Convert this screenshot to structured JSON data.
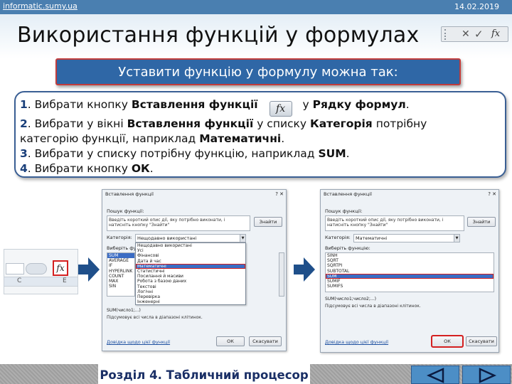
{
  "header": {
    "site": "informatic.sumy.ua",
    "date": "14.02.2019",
    "title": "Використання функцій у формулах"
  },
  "formula_bar_icons": [
    "x-icon",
    "check-icon",
    "fx-icon"
  ],
  "formula_bar": {
    "fx": "fx",
    "x": "✕",
    "check": "✓"
  },
  "subtitle": "Уставити функцію у формулу можна так:",
  "steps": [
    {
      "num": "1",
      "pre": ". Вибрати кнопку ",
      "b1": "Вставлення функції",
      "mid": " у ",
      "b2": "Рядку формул",
      "post": "."
    },
    {
      "num": "2",
      "pre": ". Вибрати у вікні ",
      "b1": "Вставлення функції",
      "mid": " у списку ",
      "b2": "Категорія",
      "post": " потрібну"
    },
    {
      "cont": "категорію функції, наприклад ",
      "b1": "Математичні",
      "post": "."
    },
    {
      "num": "3",
      "pre": ". Вибрати у списку потрібну функцію, наприклад ",
      "b1": "SUM",
      "post": "."
    },
    {
      "num": "4",
      "pre": ". Вибрати кнопку ",
      "b1": "ОК",
      "post": "."
    }
  ],
  "excel_snippet": {
    "fx": "fx",
    "col_c": "C",
    "col_e": "E"
  },
  "dialog1": {
    "title": "Вставлення функції",
    "close": "?  ✕",
    "search_label": "Пошук функції:",
    "search_text": "Введіть короткий опис дії, яку потрібно виконати, і натисніть кнопку \"Знайти\"",
    "find_button": "Знайти",
    "category_label": "Категорія:",
    "category_value": "Нещодавно використані",
    "choose_label": "Виберіть функцію:",
    "functions": [
      "SUM",
      "AVERAGE",
      "IF",
      "HYPERLINK",
      "COUNT",
      "MAX",
      "SIN"
    ],
    "dropdown_items": [
      "Нещодавно використані",
      "Усі",
      "Фінансові",
      "Дата й час",
      "Математичні",
      "Статистичні",
      "Посилання й масиви",
      "Робота з базою даних",
      "Текстові",
      "Логічні",
      "Перевірка",
      "Інженерні"
    ],
    "dropdown_selected": 4,
    "desc_title": "SUM(число1;...)",
    "desc_text": "Підсумовує всі числа в діапазоні клітинок.",
    "help_link": "Довідка щодо цієї функції",
    "ok": "ОК",
    "cancel": "Скасувати"
  },
  "dialog2": {
    "title": "Вставлення функції",
    "close": "?  ✕",
    "search_label": "Пошук функції:",
    "search_text": "Введіть короткий опис дії, яку потрібно виконати, і натисніть кнопку \"Знайти\"",
    "find_button": "Знайти",
    "category_label": "Категорія:",
    "category_value": "Математичні",
    "choose_label": "Виберіть функцію:",
    "functions": [
      "SINH",
      "SQRT",
      "SQRTPI",
      "SUBTOTAL",
      "SUM",
      "SUMIF",
      "SUMIFS"
    ],
    "selected_index": 4,
    "desc_title": "SUM(число1;число2;...)",
    "desc_text": "Підсумовує всі числа в діапазоні клітинок.",
    "help_link": "Довідка щодо цієї функції",
    "ok": "ОК",
    "cancel": "Скасувати"
  },
  "footer": {
    "section": "Розділ 4. Табличний процесор",
    "prev_icon": "triangle-left-icon",
    "next_icon": "triangle-right-icon"
  },
  "colors": {
    "topbar": "#4a7fb0",
    "subtitle_bg": "#2f67a6",
    "accent_red": "#d42020",
    "nav_button": "#4c8ec6",
    "footer_text": "#1a2f66"
  }
}
